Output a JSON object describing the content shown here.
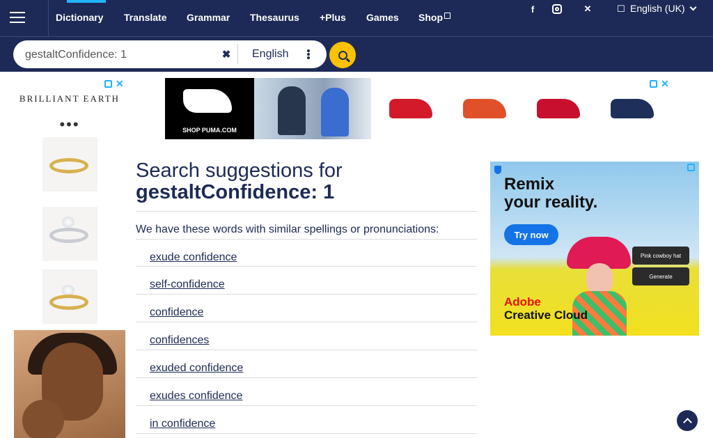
{
  "header": {
    "nav": [
      {
        "label": "Dictionary"
      },
      {
        "label": "Translate"
      },
      {
        "label": "Grammar"
      },
      {
        "label": "Thesaurus"
      },
      {
        "label": "+Plus"
      },
      {
        "label": "Games"
      },
      {
        "label": "Shop"
      }
    ],
    "language_label": "English (UK)",
    "icons": [
      "menu-icon",
      "facebook-icon",
      "instagram-icon",
      "x-icon",
      "user-icon"
    ]
  },
  "search": {
    "value": "gestaltConfidence: 1",
    "dictionary": "English"
  },
  "ads": {
    "left_brand": "BRILLIANT EARTH",
    "left_more": "•••",
    "top_puma_text": "SHOP PUMA.COM",
    "right_headline": "Remix\nyour reality.",
    "right_cta": "Try now",
    "right_pill_1": "Pink cowboy hat",
    "right_pill_2": "Generate",
    "right_brand_1": "Adobe",
    "right_brand_2": "Creative Cloud"
  },
  "main": {
    "title_line1": "Search suggestions for",
    "title_line2": "gestaltConfidence: 1",
    "intro": "We have these words with similar spellings or pronunciations:",
    "suggestions": [
      "exude confidence",
      "self-confidence",
      "confidence",
      "confidences",
      "exuded confidence",
      "exudes confidence",
      "in confidence"
    ]
  },
  "colors": {
    "navy": "#1d2a57",
    "accent_blue": "#1fb3ff",
    "search_yellow": "#fcc100"
  }
}
